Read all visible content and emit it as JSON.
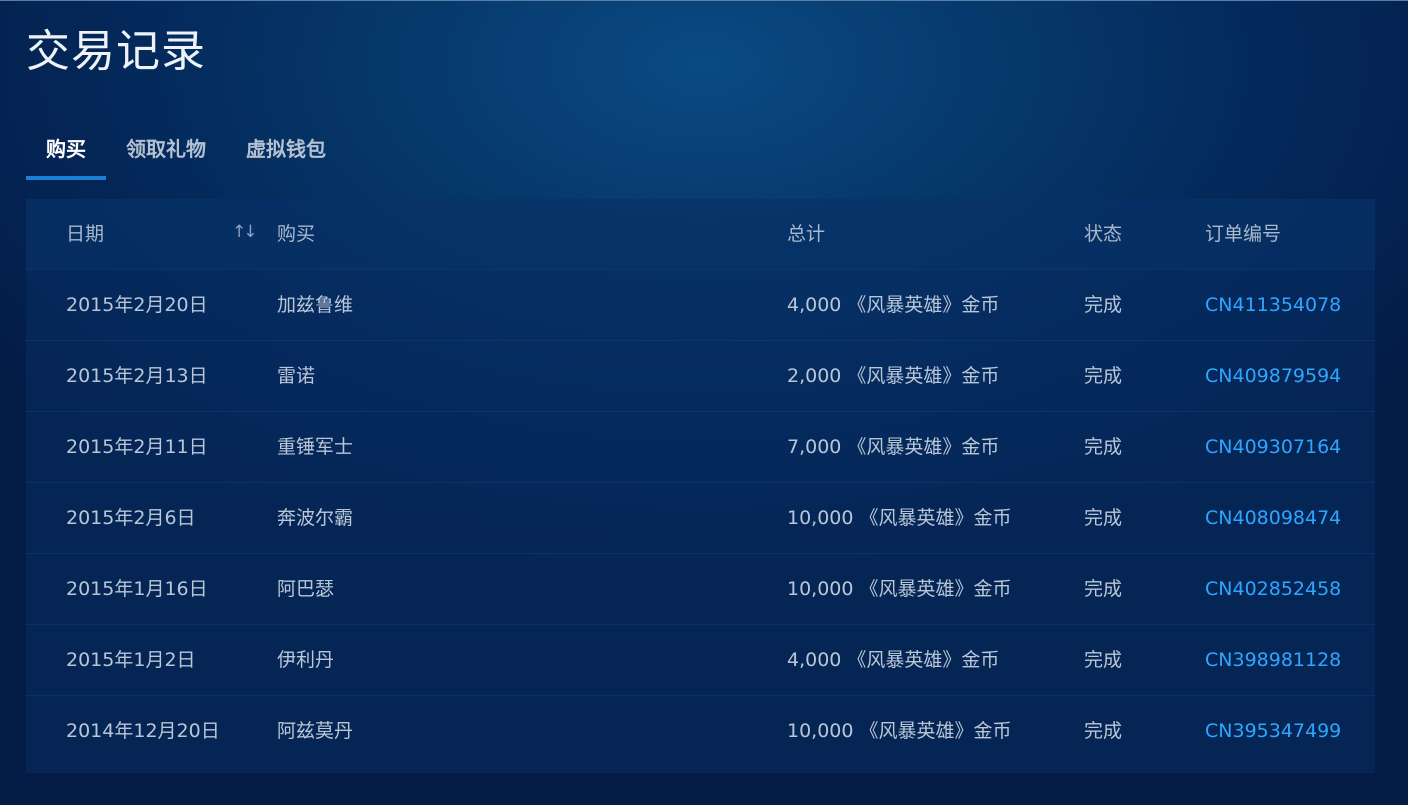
{
  "page": {
    "title": "交易记录"
  },
  "tabs": [
    {
      "label": "购买",
      "active": true
    },
    {
      "label": "领取礼物",
      "active": false
    },
    {
      "label": "虚拟钱包",
      "active": false
    }
  ],
  "table": {
    "headers": {
      "date": "日期",
      "item": "购买",
      "total": "总计",
      "status": "状态",
      "order": "订单编号",
      "sort_icon": "sort-arrows-icon"
    },
    "rows": [
      {
        "date": "2015年2月20日",
        "item": "加兹鲁维",
        "total": "4,000 《风暴英雄》金币",
        "status": "完成",
        "order": "CN411354078"
      },
      {
        "date": "2015年2月13日",
        "item": "雷诺",
        "total": "2,000 《风暴英雄》金币",
        "status": "完成",
        "order": "CN409879594"
      },
      {
        "date": "2015年2月11日",
        "item": "重锤军士",
        "total": "7,000 《风暴英雄》金币",
        "status": "完成",
        "order": "CN409307164"
      },
      {
        "date": "2015年2月6日",
        "item": "奔波尔霸",
        "total": "10,000 《风暴英雄》金币",
        "status": "完成",
        "order": "CN408098474"
      },
      {
        "date": "2015年1月16日",
        "item": "阿巴瑟",
        "total": "10,000 《风暴英雄》金币",
        "status": "完成",
        "order": "CN402852458"
      },
      {
        "date": "2015年1月2日",
        "item": "伊利丹",
        "total": "4,000 《风暴英雄》金币",
        "status": "完成",
        "order": "CN398981128"
      },
      {
        "date": "2014年12月20日",
        "item": "阿兹莫丹",
        "total": "10,000 《风暴英雄》金币",
        "status": "完成",
        "order": "CN395347499"
      }
    ]
  },
  "colors": {
    "accent": "#1b7fd6",
    "link": "#2ea6ff",
    "background": "#04285a"
  }
}
